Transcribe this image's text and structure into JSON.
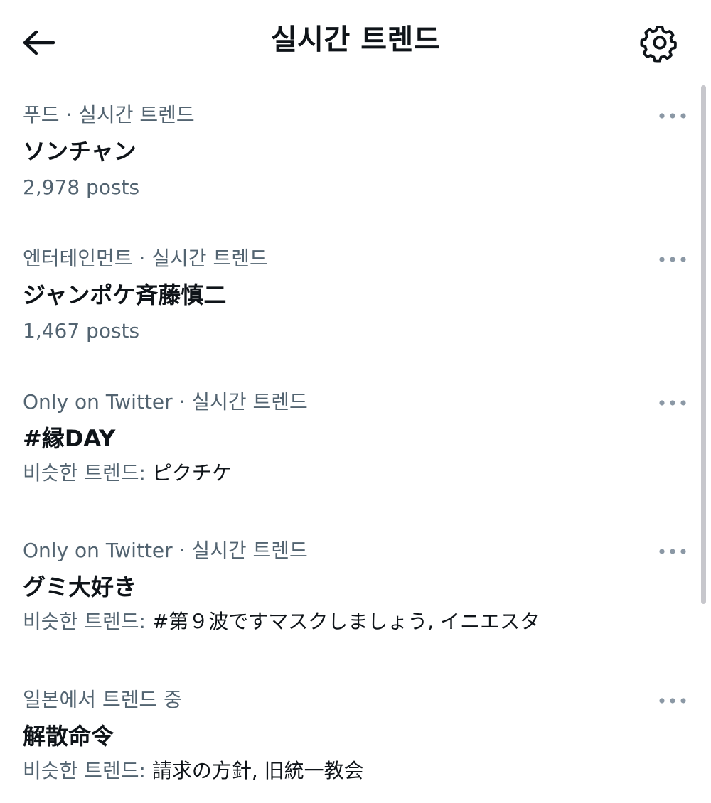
{
  "header": {
    "title": "실시간 트렌드",
    "back_icon": "arrow-left-icon",
    "settings_icon": "gear-icon"
  },
  "trends": [
    {
      "context": "푸드 · 실시간 트렌드",
      "name": "ソンチャン",
      "meta": "2,978 posts"
    },
    {
      "context": "엔터테인먼트 · 실시간 트렌드",
      "name": "ジャンポケ斉藤慎二",
      "meta": "1,467 posts"
    },
    {
      "context": "Only on Twitter · 실시간 트렌드",
      "name": "#縁DAY",
      "related_label": "비슷한 트렌드:",
      "related_values": "ピクチケ"
    },
    {
      "context": "Only on Twitter · 실시간 트렌드",
      "name": "グミ大好き",
      "related_label": "비슷한 트렌드:",
      "related_values": "#第９波ですマスクしましょう, イニエスタ"
    },
    {
      "context": "일본에서 트렌드 중",
      "name": "解散命令",
      "related_label": "비슷한 트렌드:",
      "related_values": "請求の方針, 旧統一教会"
    }
  ],
  "colors": {
    "primary_text": "#0f1419",
    "secondary_text": "#536471",
    "icon_more": "#8b98a5",
    "scrollbar": "#c7c7cc"
  }
}
